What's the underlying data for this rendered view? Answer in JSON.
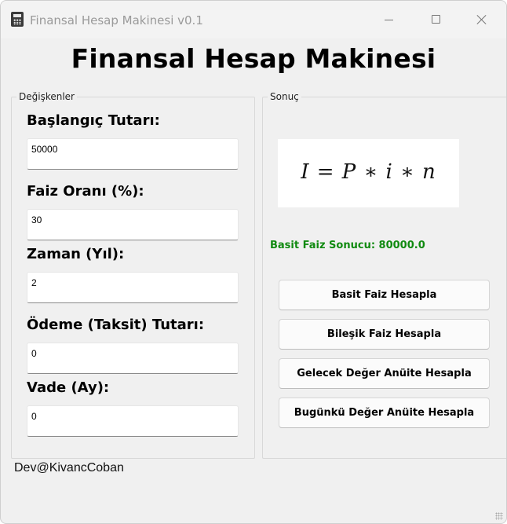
{
  "window": {
    "title": "Finansal Hesap Makinesi v0.1",
    "icon": "calculator-icon"
  },
  "heading": "Finansal Hesap Makinesi",
  "variables": {
    "group_title": "Değişkenler",
    "fields": [
      {
        "label": "Başlangıç Tutarı:",
        "value": "50000"
      },
      {
        "label": "Faiz Oranı (%):",
        "value": "30"
      },
      {
        "label": "Zaman (Yıl):",
        "value": "2"
      },
      {
        "label": "Ödeme (Taksit) Tutarı:",
        "value": "0"
      },
      {
        "label": "Vade (Ay):",
        "value": "0"
      }
    ]
  },
  "result": {
    "group_title": "Sonuç",
    "formula": "I = P ∗ i ∗ n",
    "text": "Basit Faiz Sonucu: 80000.0",
    "text_color": "#108a10"
  },
  "buttons": [
    "Basit Faiz Hesapla",
    "Bileşik Faiz Hesapla",
    "Gelecek Değer Anüite Hesapla",
    "Bugünkü Değer Anüite Hesapla"
  ],
  "footer": "Dev@KivancCoban"
}
